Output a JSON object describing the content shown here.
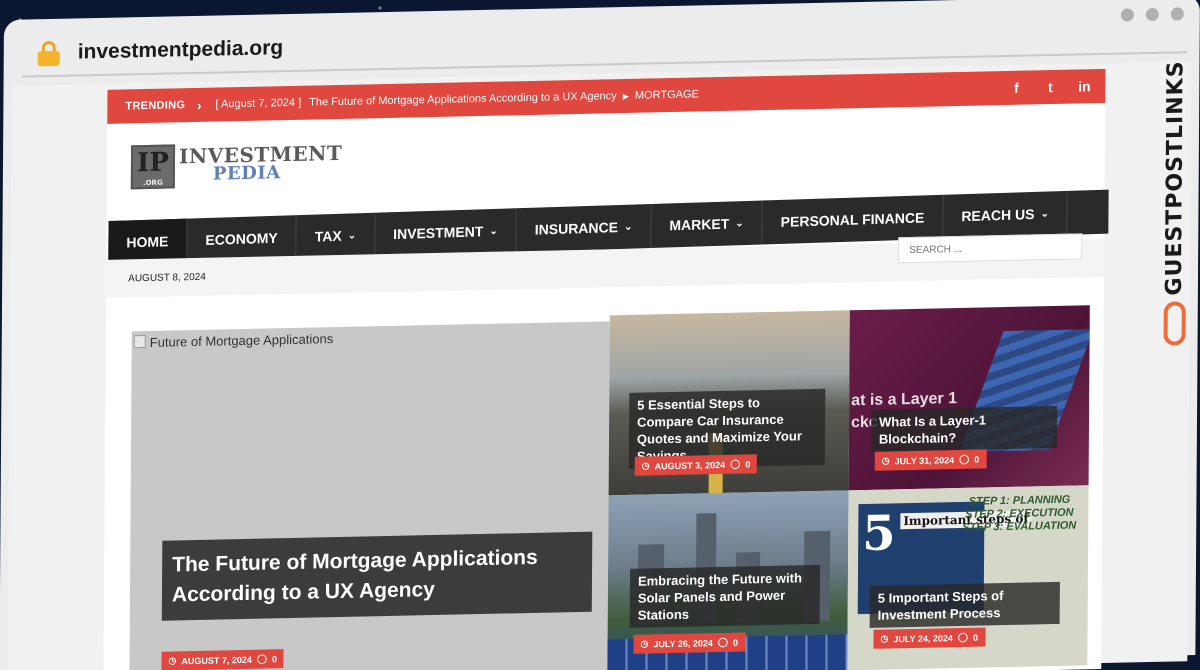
{
  "browser": {
    "url": "investmentpedia.org"
  },
  "trending": {
    "label": "TRENDING",
    "date": "[ August 7, 2024 ]",
    "title": "The Future of Mortgage Applications According to a UX Agency",
    "category": "MORTGAGE",
    "social": [
      "f",
      "t",
      "in"
    ]
  },
  "logo": {
    "mark": "IP",
    "mark_sub": ".ORG",
    "line1": "INVESTMENT",
    "line2": "PEDIA"
  },
  "nav": {
    "items": [
      {
        "label": "HOME",
        "has_dropdown": false
      },
      {
        "label": "ECONOMY",
        "has_dropdown": false
      },
      {
        "label": "TAX",
        "has_dropdown": true
      },
      {
        "label": "INVESTMENT",
        "has_dropdown": true
      },
      {
        "label": "INSURANCE",
        "has_dropdown": true
      },
      {
        "label": "MARKET",
        "has_dropdown": true
      },
      {
        "label": "PERSONAL FINANCE",
        "has_dropdown": false
      },
      {
        "label": "REACH US",
        "has_dropdown": true
      }
    ]
  },
  "datebar": {
    "date": "AUGUST 8, 2024",
    "search_placeholder": "SEARCH ..."
  },
  "featured": {
    "image_alt": "Future of Mortgage Applications",
    "title": "The Future of Mortgage Applications According to a UX Agency",
    "date": "AUGUST 7, 2024",
    "comments": "0"
  },
  "posts": [
    {
      "title": "5 Essential Steps to Compare Car Insurance Quotes and Maximize Your Savings",
      "date": "AUGUST 3, 2024",
      "comments": "0"
    },
    {
      "title": "What Is a Layer-1 Blockchain?",
      "date": "JULY 31, 2024",
      "comments": "0",
      "image_text": "at is a Layer 1\nckc"
    },
    {
      "title": "Embracing the Future with Solar Panels and Power Stations",
      "date": "JULY 26, 2024",
      "comments": "0"
    },
    {
      "title": "5 Important Steps of Investment Process",
      "date": "JULY 24, 2024",
      "comments": "0",
      "image_text": {
        "five": "5",
        "heading": "Important steps of",
        "steps": "STEP 1: PLANNING\nSTEP 2: EXECUTION\nSTEP 3: EVALUATION"
      }
    }
  ],
  "side_brand": "GUESTPOSTLINKS",
  "colors": {
    "accent": "#e0473f",
    "nav_bg": "#2a2a2a",
    "brand_orange": "#ef6b3a"
  }
}
